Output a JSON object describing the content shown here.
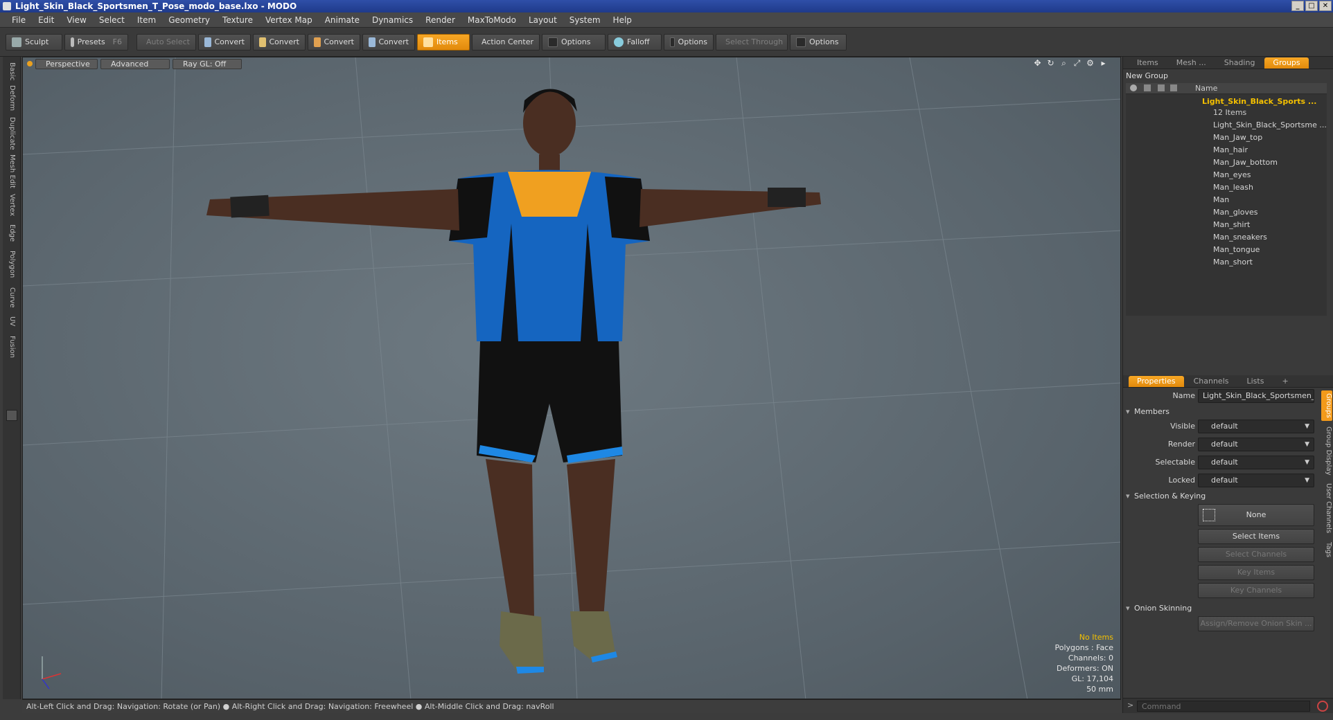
{
  "window": {
    "title": "Light_Skin_Black_Sportsmen_T_Pose_modo_base.lxo - MODO",
    "controls": [
      "_",
      "□",
      "✕"
    ]
  },
  "menu": [
    "File",
    "Edit",
    "View",
    "Select",
    "Item",
    "Geometry",
    "Texture",
    "Vertex Map",
    "Animate",
    "Dynamics",
    "Render",
    "MaxToModo",
    "Layout",
    "System",
    "Help"
  ],
  "toolbar": {
    "sculpt": "Sculpt",
    "presets": "Presets",
    "presets_key": "F6",
    "auto_select": "Auto Select",
    "convert": "Convert",
    "items": "Items",
    "action_center": "Action Center",
    "options": "Options",
    "falloff": "Falloff",
    "select_through": "Select Through"
  },
  "left_tabs": [
    "Basic",
    "Deform",
    "Duplicate",
    "Mesh Edit",
    "Vertex",
    "Edge",
    "Polygon",
    "Curve",
    "UV",
    "Fusion"
  ],
  "viewport": {
    "view": "Perspective",
    "shading": "Advanced",
    "raygl": "Ray GL: Off",
    "hud": {
      "no_items": "No Items",
      "polygons": "Polygons : Face",
      "channels": "Channels: 0",
      "deformers": "Deformers: ON",
      "gl": "GL: 17,104",
      "focal": "50 mm"
    }
  },
  "status": "Alt-Left Click and Drag: Navigation: Rotate (or Pan) ● Alt-Right Click and Drag: Navigation: Freewheel ● Alt-Middle Click and Drag: navRoll",
  "groups_panel": {
    "tabs": [
      "Items",
      "Mesh ...",
      "Shading",
      "Groups"
    ],
    "new_group": "New Group",
    "name_header": "Name",
    "group_name": "Light_Skin_Black_Sports ...",
    "item_count": "12 Items",
    "children": [
      "Light_Skin_Black_Sportsme ...",
      "Man_Jaw_top",
      "Man_hair",
      "Man_Jaw_bottom",
      "Man_eyes",
      "Man_leash",
      "Man",
      "Man_gloves",
      "Man_shirt",
      "Man_sneakers",
      "Man_tongue",
      "Man_short"
    ]
  },
  "properties_panel": {
    "tabs": [
      "Properties",
      "Channels",
      "Lists",
      "+"
    ],
    "name_label": "Name",
    "name_value": "Light_Skin_Black_Sportsmen_T_P",
    "members": "Members",
    "visible": "Visible",
    "render": "Render",
    "selectable": "Selectable",
    "locked": "Locked",
    "default": "default",
    "selection_keying": "Selection & Keying",
    "none": "None",
    "select_items": "Select Items",
    "select_channels": "Select Channels",
    "key_items": "Key Items",
    "key_channels": "Key Channels",
    "onion_skinning": "Onion Skinning",
    "assign_onion": "Assign/Remove Onion Skin ...",
    "side_tabs": [
      "Groups",
      "Group Display",
      "User Channels",
      "Tags"
    ],
    "command_placeholder": "Command"
  },
  "colors": {
    "accent": "#f39a1a",
    "selected_text": "#f4c000",
    "titlebar": "#1f3a8a"
  }
}
